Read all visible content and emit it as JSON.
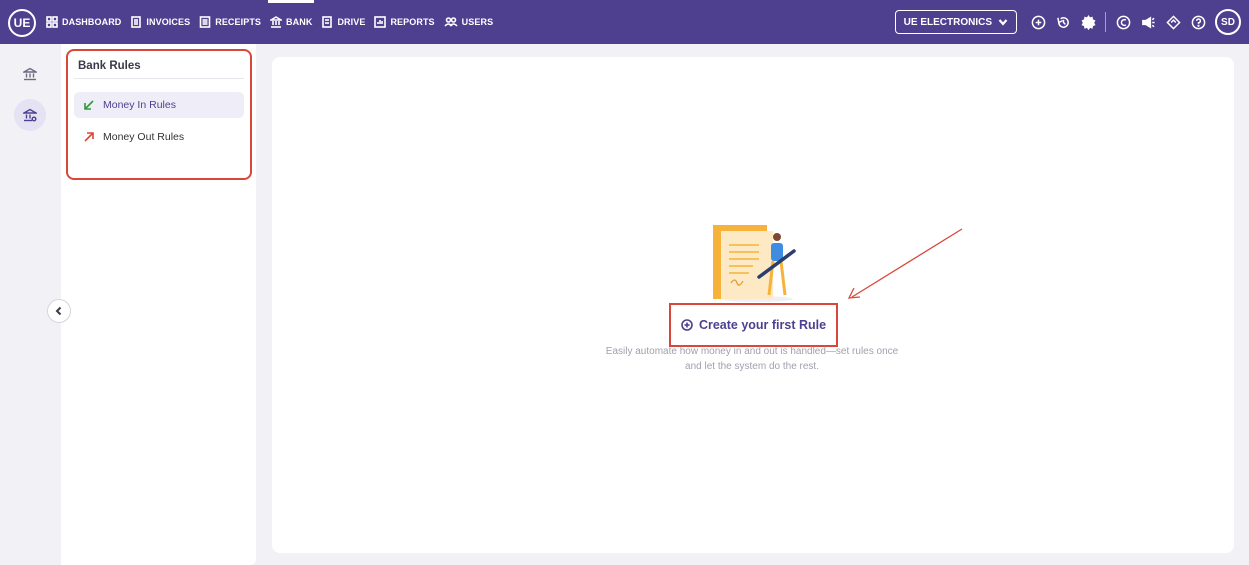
{
  "app": {
    "logo_text": "UE",
    "user_initials": "SD"
  },
  "nav": {
    "items": [
      {
        "label": "DASHBOARD",
        "icon": "grid-icon"
      },
      {
        "label": "INVOICES",
        "icon": "invoice-icon"
      },
      {
        "label": "RECEIPTS",
        "icon": "receipt-icon"
      },
      {
        "label": "BANK",
        "icon": "bank-icon",
        "active": true
      },
      {
        "label": "DRIVE",
        "icon": "document-icon"
      },
      {
        "label": "REPORTS",
        "icon": "chart-icon"
      },
      {
        "label": "USERS",
        "icon": "users-icon"
      }
    ]
  },
  "company": {
    "name": "UE ELECTRONICS"
  },
  "sidebar": {
    "title": "Bank Rules",
    "items": [
      {
        "label": "Money In Rules",
        "active": true,
        "color": "#2e9b3a"
      },
      {
        "label": "Money Out Rules",
        "active": false,
        "color": "#d9473a"
      }
    ]
  },
  "main": {
    "cta_label": "Create your first Rule",
    "hint": "Easily automate how money in and out is handled—set rules once and let the system do the rest."
  },
  "colors": {
    "brand": "#4f3f8f",
    "highlight": "#d9473a"
  }
}
